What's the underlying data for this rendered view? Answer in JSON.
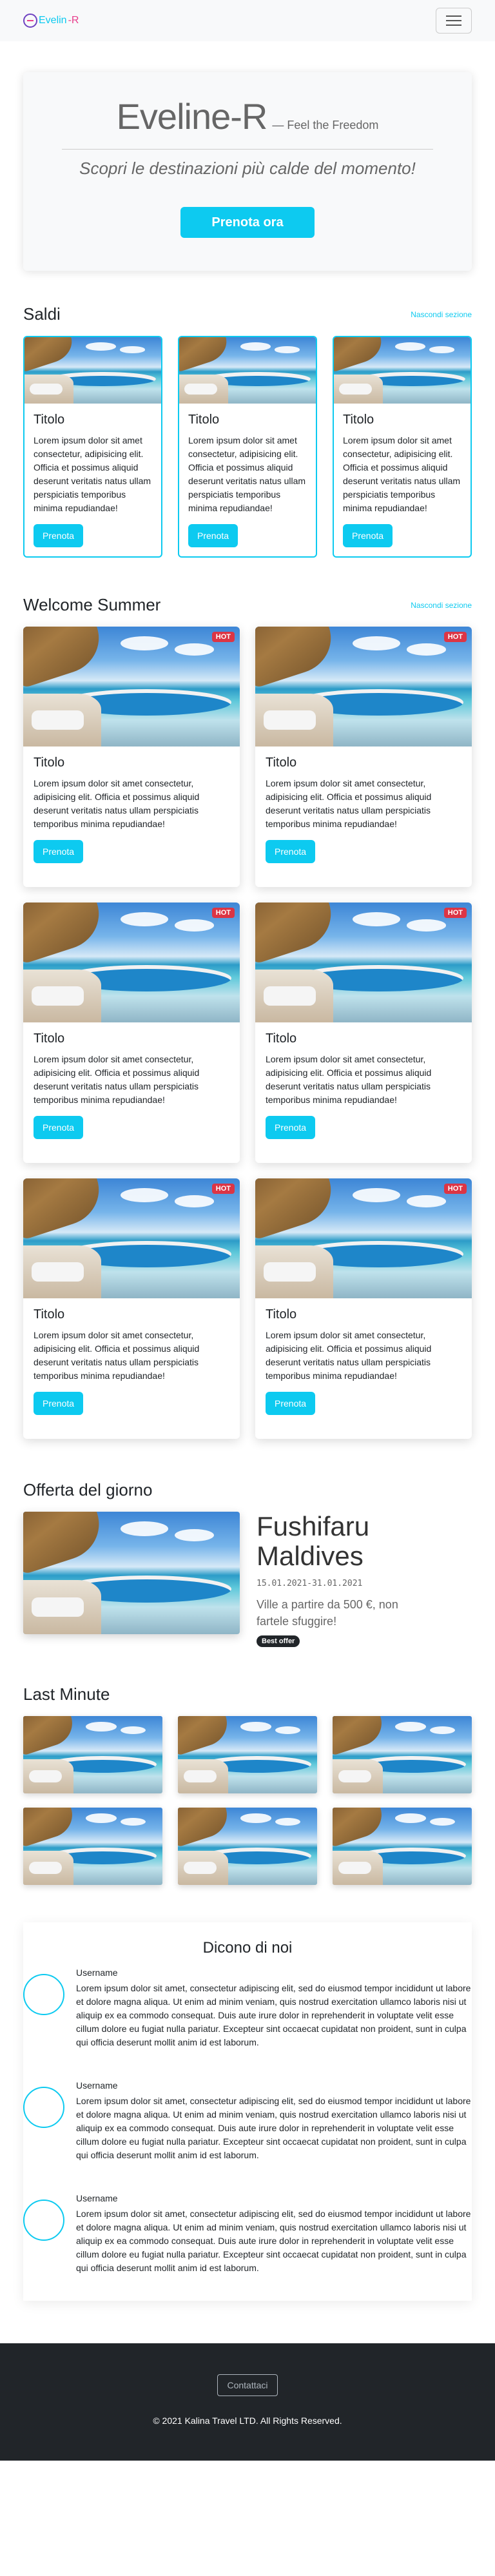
{
  "navbar": {
    "brand_name": "Evelin",
    "brand_suffix": "-R",
    "menu_icon": "hamburger-icon"
  },
  "hero": {
    "title": "Eveline-R",
    "tagline": "— Feel the Freedom",
    "subtitle": "Scopri le destinazioni più calde del momento!",
    "button": "Prenota ora"
  },
  "saldi": {
    "title": "Saldi",
    "hide_link": "Nascondi sezione",
    "cards": [
      {
        "title": "Titolo",
        "text": "Lorem ipsum dolor sit amet consectetur, adipisicing elit. Officia et possimus aliquid deserunt veritatis natus ullam perspiciatis temporibus minima repudiandae!",
        "button": "Prenota"
      },
      {
        "title": "Titolo",
        "text": "Lorem ipsum dolor sit amet consectetur, adipisicing elit. Officia et possimus aliquid deserunt veritatis natus ullam perspiciatis temporibus minima repudiandae!",
        "button": "Prenota"
      },
      {
        "title": "Titolo",
        "text": "Lorem ipsum dolor sit amet consectetur, adipisicing elit. Officia et possimus aliquid deserunt veritatis natus ullam perspiciatis temporibus minima repudiandae!",
        "button": "Prenota"
      }
    ]
  },
  "summer": {
    "title": "Welcome Summer",
    "hide_link": "Nascondi sezione",
    "cards": [
      {
        "badge": "HOT",
        "title": "Titolo",
        "text": "Lorem ipsum dolor sit amet consectetur, adipisicing elit. Officia et possimus aliquid deserunt veritatis natus ullam perspiciatis temporibus minima repudiandae!",
        "button": "Prenota"
      },
      {
        "badge": "HOT",
        "title": "Titolo",
        "text": "Lorem ipsum dolor sit amet consectetur, adipisicing elit. Officia et possimus aliquid deserunt veritatis natus ullam perspiciatis temporibus minima repudiandae!",
        "button": "Prenota"
      },
      {
        "badge": "HOT",
        "title": "Titolo",
        "text": "Lorem ipsum dolor sit amet consectetur, adipisicing elit. Officia et possimus aliquid deserunt veritatis natus ullam perspiciatis temporibus minima repudiandae!",
        "button": "Prenota"
      },
      {
        "badge": "HOT",
        "title": "Titolo",
        "text": "Lorem ipsum dolor sit amet consectetur, adipisicing elit. Officia et possimus aliquid deserunt veritatis natus ullam perspiciatis temporibus minima repudiandae!",
        "button": "Prenota"
      },
      {
        "badge": "HOT",
        "title": "Titolo",
        "text": "Lorem ipsum dolor sit amet consectetur, adipisicing elit. Officia et possimus aliquid deserunt veritatis natus ullam perspiciatis temporibus minima repudiandae!",
        "button": "Prenota"
      },
      {
        "badge": "HOT",
        "title": "Titolo",
        "text": "Lorem ipsum dolor sit amet consectetur, adipisicing elit. Officia et possimus aliquid deserunt veritatis natus ullam perspiciatis temporibus minima repudiandae!",
        "button": "Prenota"
      }
    ]
  },
  "offer": {
    "title": "Offerta del giorno",
    "name_line1": "Fushifaru",
    "name_line2": "Maldives",
    "dates": "15.01.2021-31.01.2021",
    "description": "Ville a partire da 500 €, non fartele sfuggire!",
    "badge": "Best offer"
  },
  "last_minute": {
    "title": "Last Minute",
    "count": 6
  },
  "reviews": {
    "title": "Dicono di noi",
    "items": [
      {
        "user": "Username",
        "text": "Lorem ipsum dolor sit amet, consectetur adipiscing elit, sed do eiusmod tempor incididunt ut labore et dolore magna aliqua. Ut enim ad minim veniam, quis nostrud exercitation ullamco laboris nisi ut aliquip ex ea commodo consequat. Duis aute irure dolor in reprehenderit in voluptate velit esse cillum dolore eu fugiat nulla pariatur. Excepteur sint occaecat cupidatat non proident, sunt in culpa qui officia deserunt mollit anim id est laborum."
      },
      {
        "user": "Username",
        "text": "Lorem ipsum dolor sit amet, consectetur adipiscing elit, sed do eiusmod tempor incididunt ut labore et dolore magna aliqua. Ut enim ad minim veniam, quis nostrud exercitation ullamco laboris nisi ut aliquip ex ea commodo consequat. Duis aute irure dolor in reprehenderit in voluptate velit esse cillum dolore eu fugiat nulla pariatur. Excepteur sint occaecat cupidatat non proident, sunt in culpa qui officia deserunt mollit anim id est laborum."
      },
      {
        "user": "Username",
        "text": "Lorem ipsum dolor sit amet, consectetur adipiscing elit, sed do eiusmod tempor incididunt ut labore et dolore magna aliqua. Ut enim ad minim veniam, quis nostrud exercitation ullamco laboris nisi ut aliquip ex ea commodo consequat. Duis aute irure dolor in reprehenderit in voluptate velit esse cillum dolore eu fugiat nulla pariatur. Excepteur sint occaecat cupidatat non proident, sunt in culpa qui officia deserunt mollit anim id est laborum."
      }
    ]
  },
  "footer": {
    "button": "Contattaci",
    "copyright": "© 2021 Kalina Travel LTD. All Rights Reserved."
  },
  "colors": {
    "accent": "#0dcaf0",
    "hot": "#dc3545",
    "footer_bg": "#212529"
  }
}
